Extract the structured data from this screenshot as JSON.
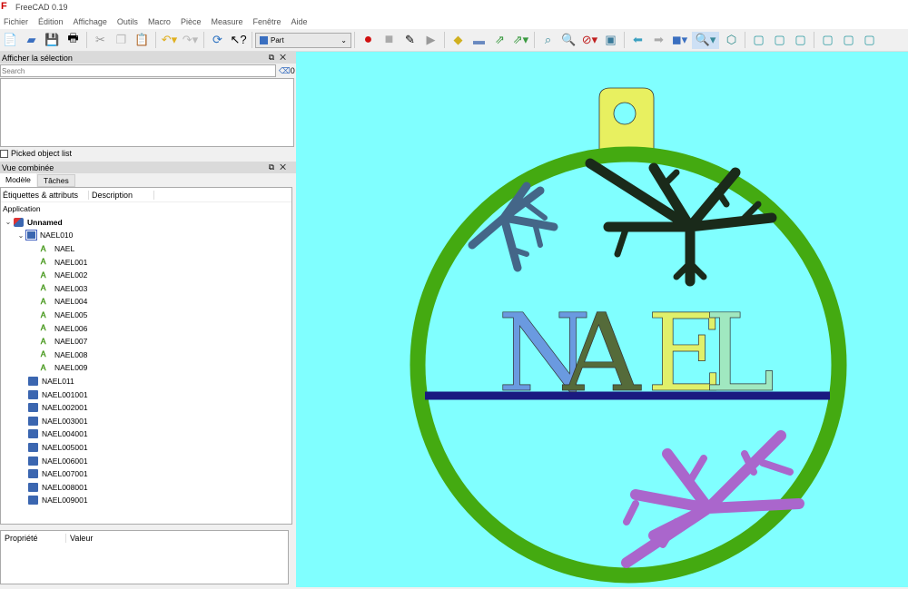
{
  "window": {
    "title": "FreeCAD 0.19"
  },
  "menu": [
    "Fichier",
    "Édition",
    "Affichage",
    "Outils",
    "Macro",
    "Pièce",
    "Measure",
    "Fenêtre",
    "Aide"
  ],
  "toolbar": {
    "workbench": "Part"
  },
  "selection_panel": {
    "title": "Afficher la sélection",
    "search_placeholder": "Search",
    "count": "0",
    "picked_label": "Picked object list"
  },
  "combo_panel": {
    "title": "Vue combinée",
    "tabs": [
      "Modèle",
      "Tâches"
    ],
    "columns": [
      "Étiquettes & attributs",
      "Description"
    ],
    "root": "Application",
    "document": "Unnamed",
    "group": "NAEL010",
    "group_children": [
      "NAEL",
      "NAEL001",
      "NAEL002",
      "NAEL003",
      "NAEL004",
      "NAEL005",
      "NAEL006",
      "NAEL007",
      "NAEL008",
      "NAEL009"
    ],
    "bodies": [
      "NAEL011",
      "NAEL001001",
      "NAEL002001",
      "NAEL003001",
      "NAEL004001",
      "NAEL005001",
      "NAEL006001",
      "NAEL007001",
      "NAEL008001",
      "NAEL009001"
    ]
  },
  "property_panel": {
    "columns": [
      "Propriété",
      "Valeur"
    ]
  },
  "viewport": {
    "text": "NAEL",
    "background": "#80ffff",
    "ring_color": "#44aa11",
    "bar_color": "#1a1a80",
    "hook_color": "#e8f060",
    "letter_colors": [
      "#6a9ae0",
      "#556b3a",
      "#e0f06a",
      "#a0e8c0"
    ]
  }
}
